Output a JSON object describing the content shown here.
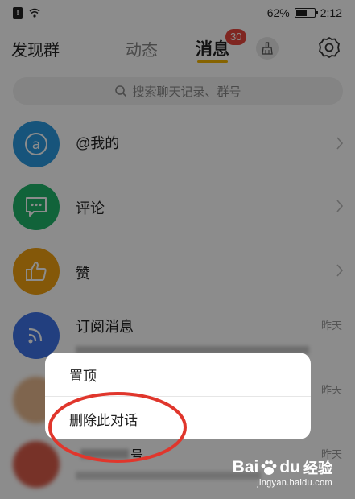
{
  "status_bar": {
    "battery_percent": "62%",
    "battery_level": 0.62,
    "time": "2:12",
    "icons": [
      "notification-icon",
      "wifi-icon",
      "battery-icon"
    ]
  },
  "header": {
    "tab_discover": "发现群",
    "tab_dynamic": "动态",
    "tab_messages": "消息",
    "messages_badge": "30",
    "icons": [
      "broom-icon",
      "gear-icon"
    ]
  },
  "search": {
    "placeholder": "搜索聊天记录、群号"
  },
  "list": {
    "items": [
      {
        "title": "@我的",
        "icon": "at-icon",
        "color": "#2a9ae0"
      },
      {
        "title": "评论",
        "icon": "comment-icon",
        "color": "#1fb46a"
      },
      {
        "title": "赞",
        "icon": "thumbs-up-icon",
        "color": "#f0a012"
      },
      {
        "title": "订阅消息",
        "icon": "rss-icon",
        "color": "#3e74e8",
        "time": "昨天"
      },
      {
        "title": "",
        "time": "昨天"
      },
      {
        "title": "",
        "time": "昨天",
        "partial_text": "号"
      }
    ]
  },
  "context_menu": {
    "pin": "置顶",
    "delete": "删除此对话"
  },
  "watermark": {
    "logo_bai": "Bai",
    "logo_du": "du",
    "logo_jingyan": "经验",
    "url": "jingyan.baidu.com"
  },
  "colors": {
    "badge": "#e8453c",
    "accent_underline": "#f5b400",
    "annotation": "#e0362c"
  }
}
